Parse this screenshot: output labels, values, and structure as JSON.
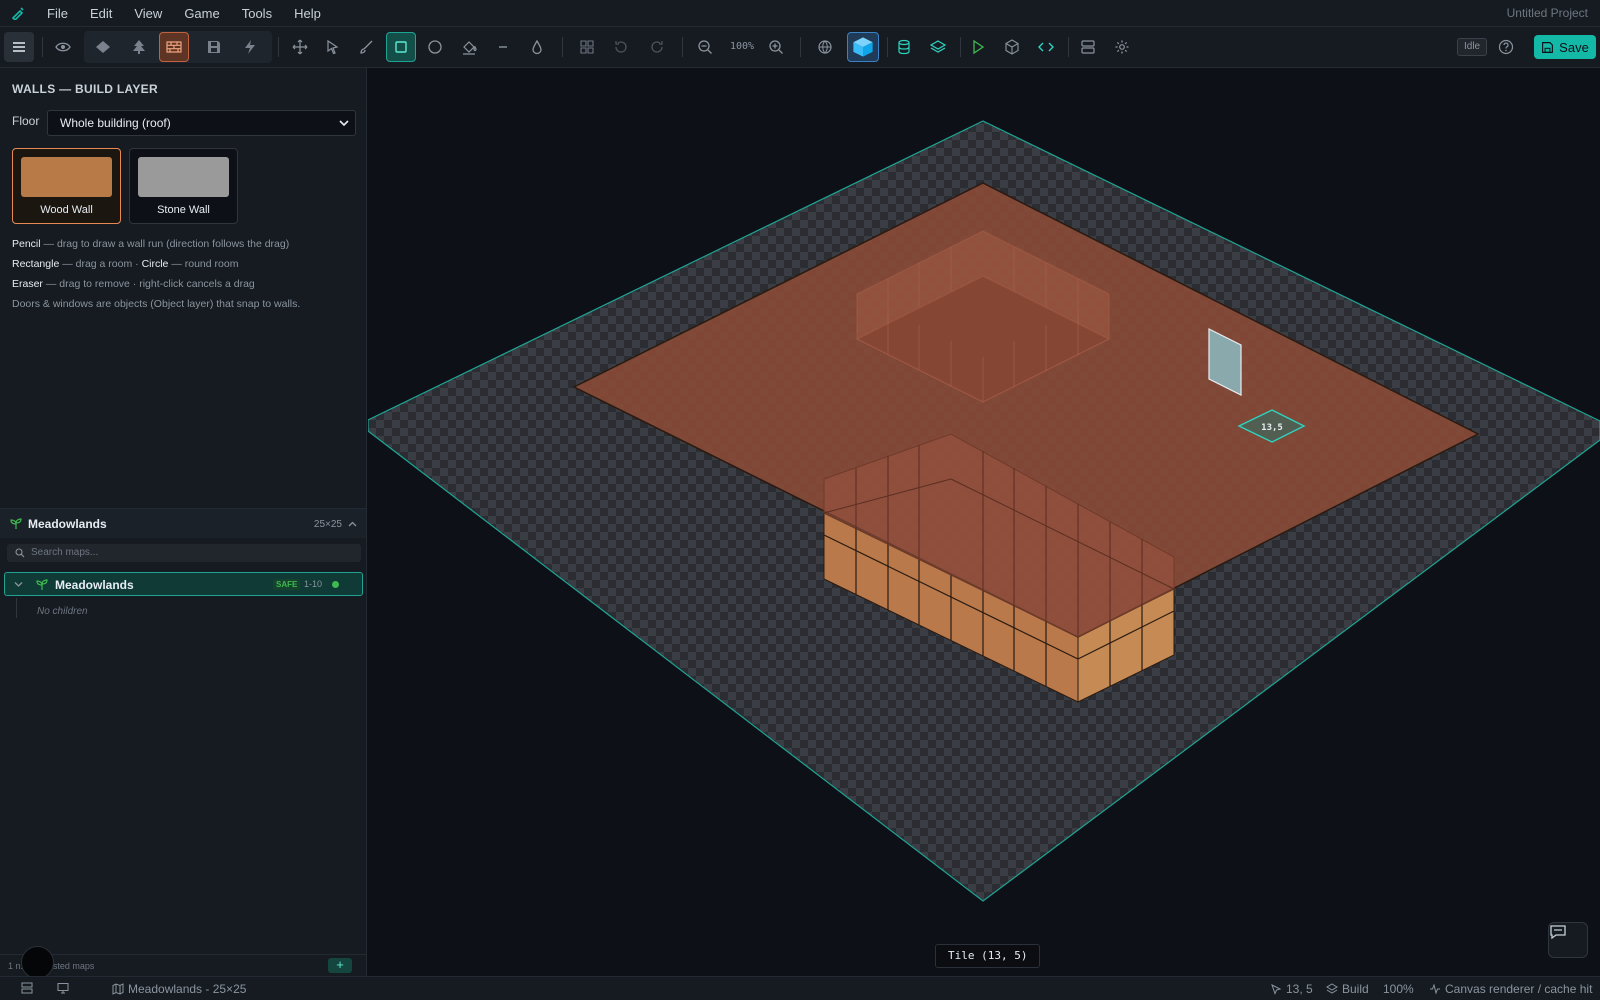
{
  "menu": [
    "File",
    "Edit",
    "View",
    "Game",
    "Tools",
    "Help"
  ],
  "project_name": "Untitled Project",
  "toolbar": {
    "zoom_label": "100%",
    "status_badge": "Idle",
    "save_label": "Save"
  },
  "left_panel": {
    "title": "WALLS — BUILD LAYER",
    "floor_label": "Floor",
    "floor_value": "Whole building (roof)",
    "walls": [
      {
        "name": "Wood Wall",
        "color": "#b87a46",
        "selected": true
      },
      {
        "name": "Stone Wall",
        "color": "#9a9a9a",
        "selected": false
      }
    ],
    "help": {
      "pencil_name": "Pencil",
      "pencil_text": " — drag to draw a wall run (direction follows the drag)",
      "rect_name": "Rectangle",
      "rect_text": " — drag a room · ",
      "circle_name": "Circle",
      "circle_text": " — round room",
      "eraser_name": "Eraser",
      "eraser_text": " — drag to remove · right-click cancels a drag",
      "doors_text": "Doors & windows are objects (Object layer) that snap to walls."
    }
  },
  "maps": {
    "header_title": "Meadowlands",
    "header_size": "25×25",
    "search_placeholder": "Search maps...",
    "items": [
      {
        "name": "Meadowlands",
        "badge": "SAFE",
        "levels": "1-10",
        "children_text": "No children"
      }
    ],
    "footer_text": "1 n... | 0 nested maps",
    "add_label": "+"
  },
  "canvas": {
    "tile_label": "13,5",
    "tooltip": "Tile (13, 5)"
  },
  "statusbar": {
    "map_info": "Meadowlands - 25×25",
    "cursor": "13, 5",
    "layer": "Build",
    "zoom": "100%",
    "renderer": "Canvas renderer / cache hit"
  },
  "colors": {
    "accent": "#14b8a6",
    "wood": "#b87a46",
    "roof": "#8a4a37",
    "grid_edge": "#1fa393"
  }
}
